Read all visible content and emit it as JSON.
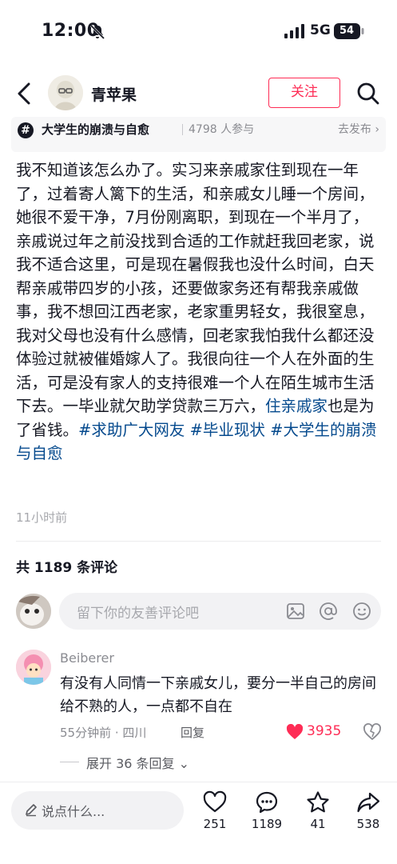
{
  "status_bar": {
    "time": "12:00",
    "network": "5G",
    "battery": "54"
  },
  "header": {
    "username": "青苹果",
    "follow_label": "关注"
  },
  "topic": {
    "title": "大学生的崩溃与自愈",
    "participants": "4798 人参与",
    "action": "去发布"
  },
  "post": {
    "text": "我不知道该怎么办了。实习来亲戚家住到现在一年了，过着寄人篱下的生活，和亲戚女儿睡一个房间，她很不爱干净，7月份刚离职，到现在一个半月了，亲戚说过年之前没找到合适的工作就赶我回老家，说我不适合这里，可是现在暑假我也没什么时间，白天帮亲戚带四岁的小孩，还要做家务还有帮我亲戚做事，我不想回江西老家，老家重男轻女，我很窒息，我对父母也没有什么感情，回老家我怕我什么都还没体验过就被催婚嫁人了。我很向往一个人在外面的生活，可是没有家人的支持很难一个人在陌生城市生活下去。一毕业就欠助学贷款三万六，",
    "link": "住亲戚家",
    "text_after": "也是为了省钱。",
    "tags": [
      "#求助广大网友",
      "#毕业现状",
      "#大学生的崩溃与自愈"
    ],
    "time": "11小时前"
  },
  "comments_section": {
    "count_label": "共 1189 条评论",
    "input_placeholder": "留下你的友善评论吧"
  },
  "comment": {
    "user": "Beiberer",
    "text": "有没有人同情一下亲戚女儿，要分一半自己的房间给不熟的人，一点都不自在",
    "meta": "55分钟前 · 四川",
    "reply_label": "回复",
    "likes": "3935",
    "expand_label": "展开 36 条回复"
  },
  "bottom_bar": {
    "say_placeholder": "说点什么...",
    "likes": "251",
    "comments": "1189",
    "favorites": "41",
    "shares": "538"
  },
  "colors": {
    "accent": "#fe2c55",
    "link": "#04498d",
    "text": "#161823",
    "muted": "#8a8b91"
  }
}
